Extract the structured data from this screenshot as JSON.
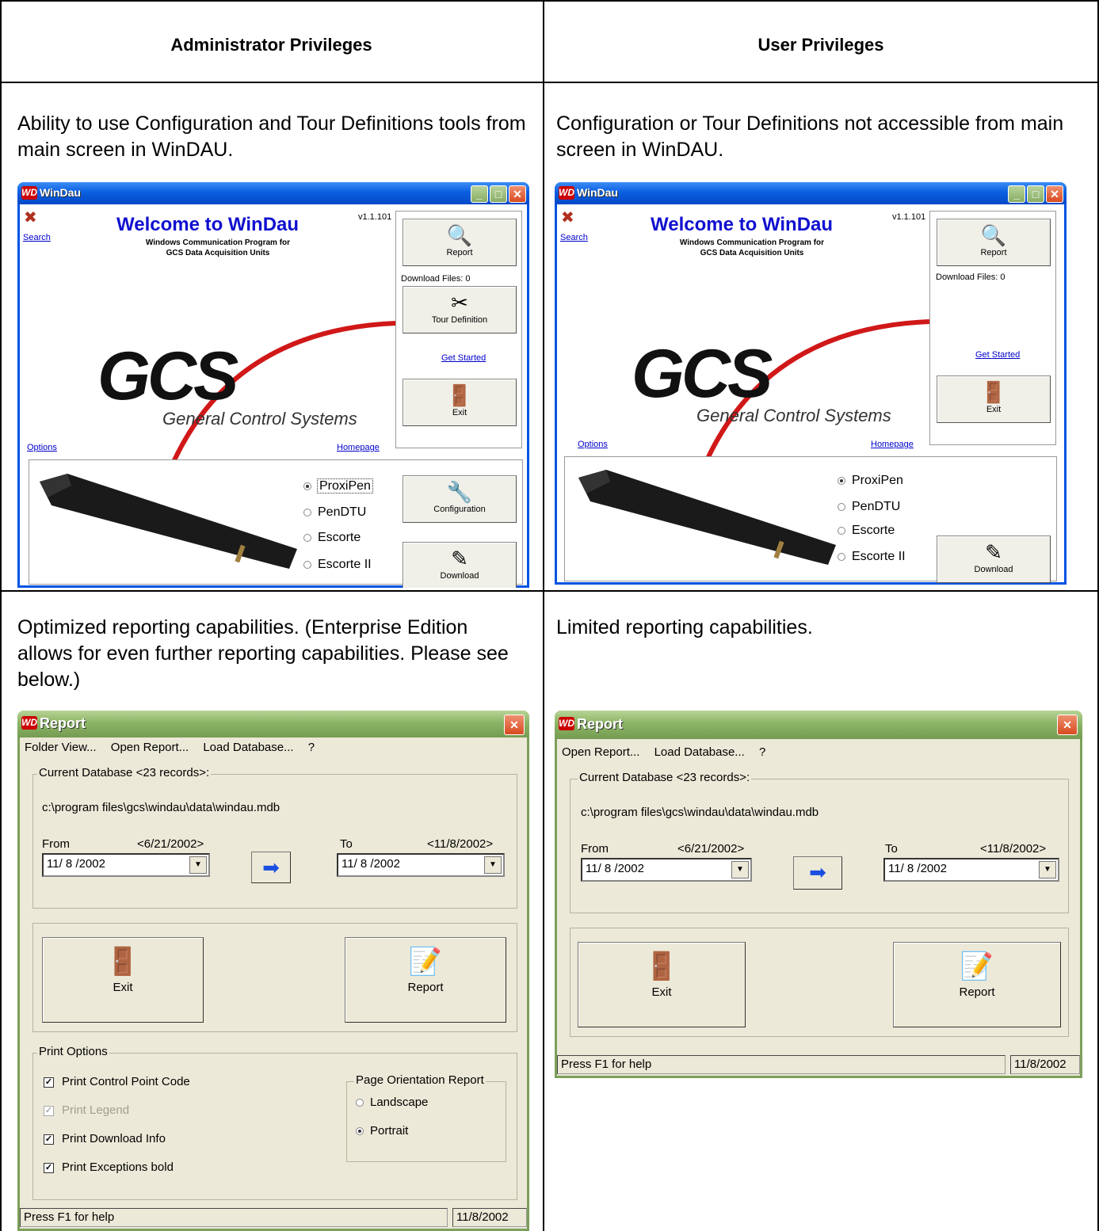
{
  "table": {
    "left_header": "Administrator Privileges",
    "right_header": "User Privileges",
    "admin_desc_1": "Ability to use Configuration and Tour Definitions tools from main screen in WinDAU.",
    "user_desc_1": "Configuration or Tour Definitions not accessible from main screen in WinDAU.",
    "admin_desc_2": "Optimized reporting capabilities.  (Enterprise Edition allows for even further reporting capabilities.  Please see below.)",
    "user_desc_2": "Limited reporting capabilities."
  },
  "windau": {
    "title": "WinDau",
    "icon_text": "WD",
    "search": "Search",
    "welcome": "Welcome to WinDau",
    "sub1": "Windows Communication Program for",
    "sub2": "GCS Data Acquisition Units",
    "version": "v1.1.101",
    "gcs": "GCS",
    "gcs_sub": "General Control Systems",
    "options": "Options",
    "homepage": "Homepage",
    "report_btn": "Report",
    "download_files": "Download Files: 0",
    "tour_btn": "Tour Definition",
    "get_started": "Get Started",
    "exit_btn": "Exit",
    "config_btn": "Configuration",
    "download_btn": "Download",
    "devices": [
      "ProxiPen",
      "PenDTU",
      "Escorte",
      "Escorte II"
    ]
  },
  "report": {
    "title": "Report",
    "icon_text": "WD",
    "menu_admin": [
      "Folder View...",
      "Open Report...",
      "Load Database...",
      "?"
    ],
    "menu_user": [
      "Open Report...",
      "Load Database...",
      "?"
    ],
    "current_db": "Current Database <23 records>:",
    "db_path": "c:\\program files\\gcs\\windau\\data\\windau.mdb",
    "from_label": "From",
    "from_range": "<6/21/2002>",
    "to_label": "To",
    "to_range": "<11/8/2002>",
    "from_value": "11/ 8 /2002",
    "to_value": "11/ 8 /2002",
    "exit_btn": "Exit",
    "report_btn": "Report",
    "print_options": "Print Options",
    "chk1": "Print Control Point Code",
    "chk2": "Print Legend",
    "chk3": "Print Download Info",
    "chk4": "Print Exceptions bold",
    "orientation": "Page Orientation Report",
    "landscape": "Landscape",
    "portrait": "Portrait",
    "status_help": "Press F1 for help",
    "status_date": "11/8/2002"
  }
}
